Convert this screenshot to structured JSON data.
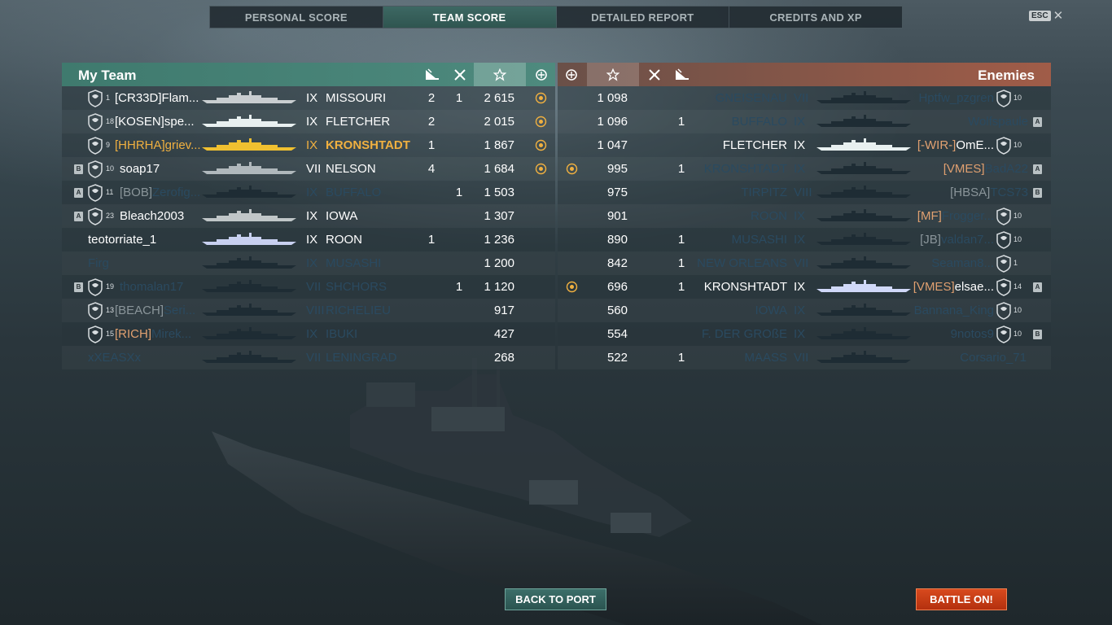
{
  "tabs": [
    {
      "label": "PERSONAL SCORE",
      "active": false
    },
    {
      "label": "TEAM SCORE",
      "active": true
    },
    {
      "label": "DETAILED REPORT",
      "active": false
    },
    {
      "label": "CREDITS AND XP",
      "active": false
    }
  ],
  "esc_label": "ESC",
  "my_team": {
    "title": "My Team",
    "rows": [
      {
        "rank": "1",
        "clan": "[CR33D]",
        "name": "Flam...",
        "tier": "IX",
        "ship": "MISSOURI",
        "kills": "2",
        "caps": "1",
        "score": "2 615",
        "medal": true,
        "style": "normal",
        "silhouette": "#c8cdd0",
        "division": ""
      },
      {
        "rank": "18",
        "clan": "[KOSEN]",
        "name": "spe...",
        "tier": "IX",
        "ship": "FLETCHER",
        "kills": "2",
        "caps": "",
        "score": "2 015",
        "medal": true,
        "style": "normal",
        "silhouette": "#e8f0f0",
        "division": ""
      },
      {
        "rank": "9",
        "clan": "[HHRHA]",
        "name": "griev...",
        "tier": "IX",
        "ship": "KRONSHTADT",
        "kills": "1",
        "caps": "",
        "score": "1 867",
        "medal": true,
        "style": "gold",
        "silhouette": "#f0c030",
        "division": ""
      },
      {
        "rank": "10",
        "clan": "",
        "name": "soap17",
        "tier": "VII",
        "ship": "NELSON",
        "kills": "4",
        "caps": "",
        "score": "1 684",
        "medal": true,
        "style": "normal",
        "silhouette": "#b0b8bc",
        "division": "B"
      },
      {
        "rank": "11",
        "clan": "[BOB]",
        "name": "Zerofig...",
        "tier": "IX",
        "ship": "BUFFALO",
        "kills": "",
        "caps": "1",
        "score": "1 503",
        "medal": false,
        "style": "dim",
        "silhouette": "#1e2c34",
        "division": "A"
      },
      {
        "rank": "23",
        "clan": "",
        "name": "Bleach2003",
        "tier": "IX",
        "ship": "IOWA",
        "kills": "",
        "caps": "",
        "score": "1 307",
        "medal": false,
        "style": "normal",
        "silhouette": "#c0c6c8",
        "division": "A"
      },
      {
        "rank": "",
        "clan": "",
        "name": "teotorriate_1",
        "tier": "IX",
        "ship": "ROON",
        "kills": "1",
        "caps": "",
        "score": "1 236",
        "medal": false,
        "style": "normal",
        "silhouette": "#c8d0f0",
        "division": ""
      },
      {
        "rank": "",
        "clan": "",
        "name": "Firg",
        "tier": "IX",
        "ship": "MUSASHI",
        "kills": "",
        "caps": "",
        "score": "1 200",
        "medal": false,
        "style": "dim",
        "silhouette": "#1e2c34",
        "division": ""
      },
      {
        "rank": "19",
        "clan": "",
        "name": "thomalan17",
        "tier": "VII",
        "ship": "SHCHORS",
        "kills": "",
        "caps": "1",
        "score": "1 120",
        "medal": false,
        "style": "dim",
        "silhouette": "#1e2c34",
        "division": "B"
      },
      {
        "rank": "13",
        "clan": "[BEACH]",
        "name": "Seri...",
        "tier": "VIII",
        "ship": "RICHELIEU",
        "kills": "",
        "caps": "",
        "score": "917",
        "medal": false,
        "style": "dim",
        "silhouette": "#1e2c34",
        "division": ""
      },
      {
        "rank": "15",
        "clan": "[RICH]",
        "name": "Mirek...",
        "tier": "IX",
        "ship": "IBUKI",
        "kills": "",
        "caps": "",
        "score": "427",
        "medal": false,
        "style": "dim-clan",
        "silhouette": "#1e2c34",
        "division": ""
      },
      {
        "rank": "",
        "clan": "",
        "name": "xXEASXx",
        "tier": "VII",
        "ship": "LENINGRAD",
        "kills": "",
        "caps": "",
        "score": "268",
        "medal": false,
        "style": "dim",
        "silhouette": "#1e2c34",
        "division": ""
      }
    ]
  },
  "enemies": {
    "title": "Enemies",
    "rows": [
      {
        "medal": false,
        "score": "1 098",
        "caps": "",
        "kills": "",
        "ship": "GNEISENAU",
        "tier": "VII",
        "clan": "",
        "name": "Hptfw_pzgren",
        "rank": "10",
        "style": "dim",
        "silhouette": "#1e2c34",
        "division": ""
      },
      {
        "medal": false,
        "score": "1 096",
        "caps": "",
        "kills": "1",
        "ship": "BUFFALO",
        "tier": "IX",
        "clan": "",
        "name": "Wolfspaule",
        "rank": "",
        "style": "dim",
        "silhouette": "#1e2c34",
        "division": "A"
      },
      {
        "medal": false,
        "score": "1 047",
        "caps": "",
        "kills": "",
        "ship": "FLETCHER",
        "tier": "IX",
        "clan": "[-WIR-]",
        "name": "OmE...",
        "rank": "10",
        "style": "normal",
        "silhouette": "#e8f0f0",
        "division": ""
      },
      {
        "medal": true,
        "score": "995",
        "caps": "",
        "kills": "1",
        "ship": "KRONSHTADT",
        "tier": "IX",
        "clan": "[VMES]",
        "name": "BadA22",
        "rank": "",
        "style": "dim-clan",
        "silhouette": "#1e2c34",
        "division": "A"
      },
      {
        "medal": false,
        "score": "975",
        "caps": "",
        "kills": "",
        "ship": "TIRPITZ",
        "tier": "VIII",
        "clan": "[HBSA]",
        "name": "TCS73",
        "rank": "",
        "style": "dim-grey",
        "silhouette": "#1e2c34",
        "division": "B"
      },
      {
        "medal": false,
        "score": "901",
        "caps": "",
        "kills": "",
        "ship": "ROON",
        "tier": "IX",
        "clan": "[MF]",
        "name": "Frogger...",
        "rank": "10",
        "style": "dim-clan",
        "silhouette": "#1e2c34",
        "division": ""
      },
      {
        "medal": false,
        "score": "890",
        "caps": "",
        "kills": "1",
        "ship": "MUSASHI",
        "tier": "IX",
        "clan": "[JB]",
        "name": "valdan7...",
        "rank": "10",
        "style": "dim-grey",
        "silhouette": "#1e2c34",
        "division": ""
      },
      {
        "medal": false,
        "score": "842",
        "caps": "",
        "kills": "1",
        "ship": "NEW ORLEANS",
        "tier": "VII",
        "clan": "",
        "name": "Seaman8...",
        "rank": "1",
        "style": "dim",
        "silhouette": "#1e2c34",
        "division": ""
      },
      {
        "medal": true,
        "score": "696",
        "caps": "",
        "kills": "1",
        "ship": "KRONSHTADT",
        "tier": "IX",
        "clan": "[VMES]",
        "name": "elsae...",
        "rank": "14",
        "style": "normal",
        "silhouette": "#d0d8f8",
        "division": "A"
      },
      {
        "medal": false,
        "score": "560",
        "caps": "",
        "kills": "",
        "ship": "IOWA",
        "tier": "IX",
        "clan": "",
        "name": "Bannana_King",
        "rank": "10",
        "style": "dim",
        "silhouette": "#1e2c34",
        "division": ""
      },
      {
        "medal": false,
        "score": "554",
        "caps": "",
        "kills": "",
        "ship": "F. DER GROßE",
        "tier": "IX",
        "clan": "",
        "name": "9notos9",
        "rank": "10",
        "style": "dim",
        "silhouette": "#1e2c34",
        "division": "B"
      },
      {
        "medal": false,
        "score": "522",
        "caps": "",
        "kills": "1",
        "ship": "MAASS",
        "tier": "VII",
        "clan": "",
        "name": "Corsario_71",
        "rank": "",
        "style": "dim",
        "silhouette": "#1e2c34",
        "division": ""
      }
    ]
  },
  "buttons": {
    "back": "BACK TO PORT",
    "battle": "BATTLE ON!"
  },
  "colors": {
    "accent_team": "#3f7a6e",
    "accent_enemy": "#a05c48",
    "gold": "#f0b040",
    "battle": "#c8380f"
  }
}
